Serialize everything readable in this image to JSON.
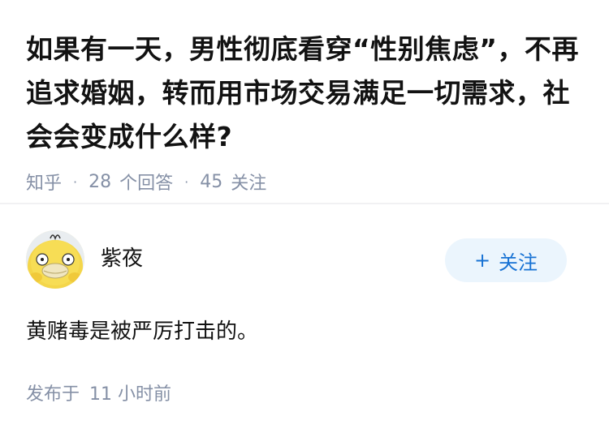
{
  "question": {
    "title": "如果有一天，男性彻底看穿“性别焦虑”，不再追求婚姻，转而用市场交易满足一切需求，社会会变成什么样?",
    "source": "知乎",
    "answers_count": "28",
    "answers_label": "个回答",
    "followers_count": "45",
    "followers_label": "关注"
  },
  "answer": {
    "author_name": "紫夜",
    "follow_plus": "+",
    "follow_label": "关注",
    "content": "黄赌毒是被严厉打击的。",
    "published_prefix": "发布于",
    "published_value": "11 小时前"
  },
  "colors": {
    "meta_gray": "#8590a6",
    "follow_bg": "#ebf5fd",
    "follow_text": "#1772d4",
    "text": "#121212"
  }
}
